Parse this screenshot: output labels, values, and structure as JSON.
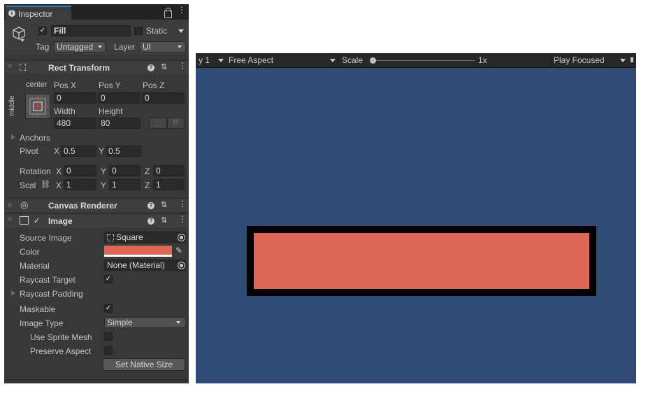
{
  "inspector": {
    "tab_label": "Inspector",
    "object": {
      "name": "Fill",
      "active": true,
      "static_label": "Static",
      "tag_label": "Tag",
      "tag_value": "Untagged",
      "layer_label": "Layer",
      "layer_value": "UI"
    },
    "rect_transform": {
      "title": "Rect Transform",
      "anchor_h": "center",
      "anchor_v": "middle",
      "pos_x_label": "Pos X",
      "pos_y_label": "Pos Y",
      "pos_z_label": "Pos Z",
      "pos_x": "0",
      "pos_y": "0",
      "pos_z": "0",
      "width_label": "Width",
      "height_label": "Height",
      "width": "480",
      "height": "80",
      "r_button": "R",
      "anchors_label": "Anchors",
      "pivot_label": "Pivot",
      "pivot_x": "0.5",
      "pivot_y": "0.5",
      "rotation_label": "Rotation",
      "rot_x": "0",
      "rot_y": "0",
      "rot_z": "0",
      "scale_label": "Scal",
      "scale_x": "1",
      "scale_y": "1",
      "scale_z": "1",
      "axis_x": "X",
      "axis_y": "Y",
      "axis_z": "Z"
    },
    "canvas_renderer": {
      "title": "Canvas Renderer"
    },
    "image": {
      "title": "Image",
      "enabled": true,
      "source_image_label": "Source Image",
      "source_image_value": "Square",
      "color_label": "Color",
      "color_value": "#dc6756",
      "material_label": "Material",
      "material_value": "None (Material)",
      "raycast_target_label": "Raycast Target",
      "raycast_padding_label": "Raycast Padding",
      "maskable_label": "Maskable",
      "image_type_label": "Image Type",
      "image_type_value": "Simple",
      "use_sprite_mesh_label": "Use Sprite Mesh",
      "preserve_aspect_label": "Preserve Aspect",
      "set_native_size_label": "Set Native Size"
    }
  },
  "game_view": {
    "display_fragment": "y 1",
    "aspect_value": "Free Aspect",
    "scale_label": "Scale",
    "scale_value": "1x",
    "play_mode_value": "Play Focused",
    "background_color": "#2f4a74",
    "fill_color": "#dc6756",
    "border_color": "#000000"
  },
  "colors": {
    "accent": "#3a79bb",
    "panel_bg": "#383838"
  }
}
